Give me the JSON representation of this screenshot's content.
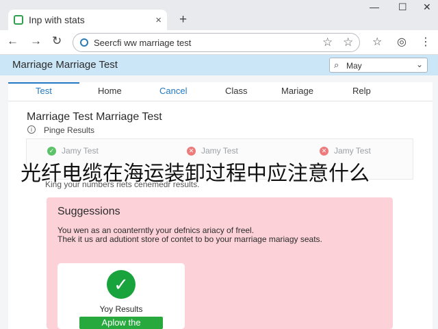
{
  "browser": {
    "tab_title": "Inp with stats",
    "tab_close": "×",
    "new_tab": "+",
    "address": "Seercfi ww marriage test",
    "window_controls": {
      "minimize": "—",
      "maximize": "☐",
      "close": "✕"
    },
    "nav_icons": {
      "back": "←",
      "forward": "→",
      "reload": "↻"
    }
  },
  "app": {
    "title": "Marriage Marriage Test",
    "select_value": "May"
  },
  "nav_tabs": [
    {
      "label": "Test",
      "state": "active"
    },
    {
      "label": "Home",
      "state": "normal"
    },
    {
      "label": "Cancel",
      "state": "link"
    },
    {
      "label": "Class",
      "state": "normal"
    },
    {
      "label": "Mariage",
      "state": "normal"
    },
    {
      "label": "Relp",
      "state": "normal"
    }
  ],
  "main": {
    "title": "Marriage Test Marriage Test",
    "subtitle": "Pinge Results",
    "results": [
      {
        "label": "Jamy Test",
        "status": "pass",
        "color": "#5cc36a"
      },
      {
        "label": "Jamy Test",
        "status": "fail",
        "color": "#ee7b7b"
      },
      {
        "label": "Jamy Test",
        "status": "fail",
        "color": "#ee7b7b"
      }
    ],
    "overlay_caption": "光纤电缆在海运装卸过程中应注意什么",
    "hint": "King your numbers riets cenemedr results."
  },
  "suggestions": {
    "title": "Suggessions",
    "body_line1": "You wen as an coanterntly your defnics ariacy of freel.",
    "body_line2": "Thek it us ard adutiont store of contet to bo your marriage mariagy seats.",
    "card_title": "Yoy Results",
    "card_button": "Aplow the"
  },
  "colors": {
    "accent": "#2178c4",
    "appbar": "#cbe6f7",
    "suggestion_bg": "#fcd2d8",
    "success": "#19a33c"
  }
}
